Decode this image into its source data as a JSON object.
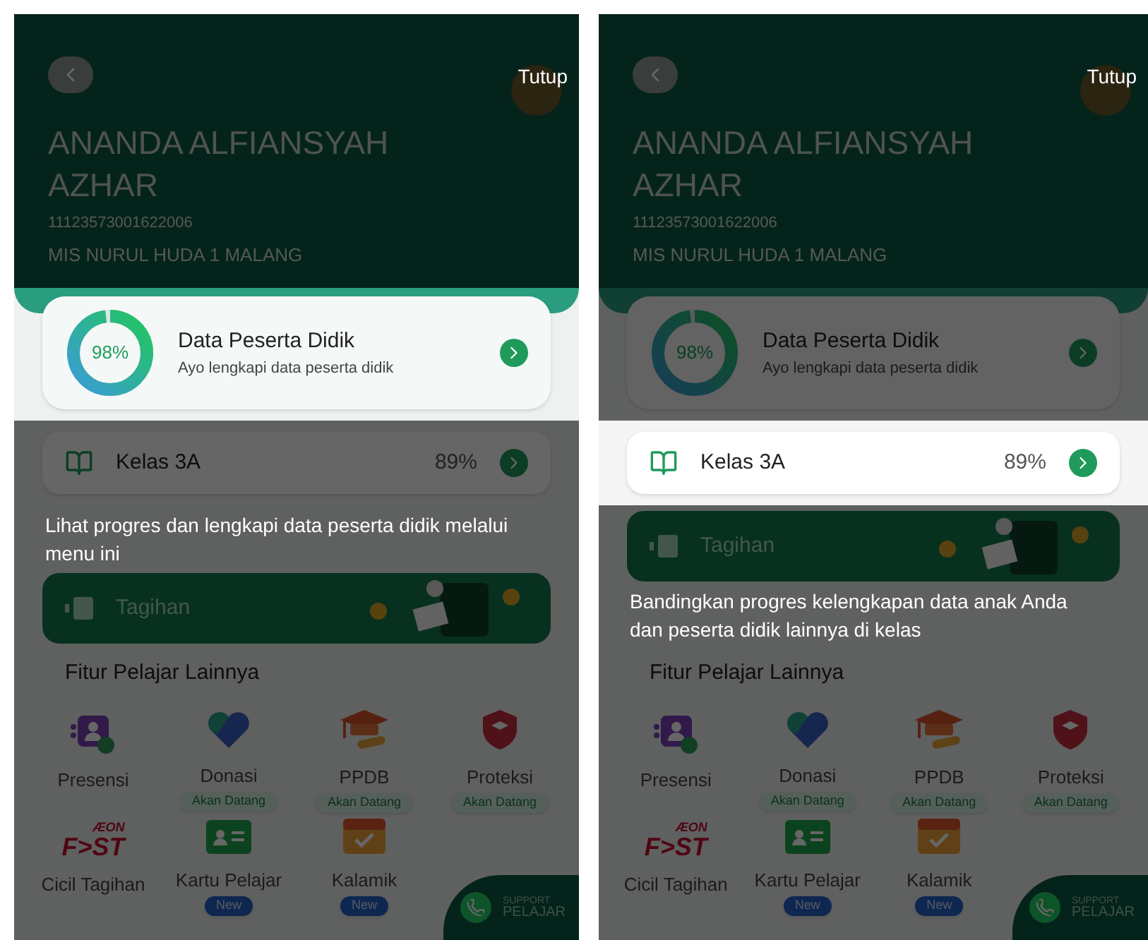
{
  "screens": [
    {
      "close_label": "Tutup",
      "tooltip": "Lihat progres dan lengkapi data peserta didik melalui menu ini",
      "student": {
        "name": "ANANDA ALFIANSYAH AZHAR",
        "id_number": "11123573001622006",
        "school": "MIS NURUL HUDA 1 MALANG"
      },
      "data_card": {
        "highlighted": true,
        "percent": "98%",
        "level": 0.98,
        "title": "Data Peserta Didik",
        "subtitle": "Ayo lengkapi data peserta didik"
      },
      "class_row": {
        "highlighted": false,
        "label": "Kelas 3A",
        "percent": "89%"
      },
      "billing_banner": {
        "label": "Tagihan"
      },
      "features_title": "Fitur Pelajar Lainnya",
      "features": [
        {
          "kind": "presence",
          "label": "Presensi"
        },
        {
          "kind": "donation",
          "label": "Donasi",
          "badge": {
            "kind": "soon",
            "text": "Akan Datang"
          }
        },
        {
          "kind": "graduation",
          "label": "PPDB",
          "badge": {
            "kind": "soon",
            "text": "Akan Datang"
          }
        },
        {
          "kind": "shield",
          "label": "Proteksi",
          "badge": {
            "kind": "soon",
            "text": "Akan Datang"
          }
        },
        {
          "kind": "logo",
          "label": "Cicil Tagihan",
          "logo": [
            "ÆON",
            "F>ST"
          ]
        },
        {
          "kind": "card",
          "label": "Kartu Pelajar",
          "badge": {
            "kind": "new",
            "text": "New"
          }
        },
        {
          "kind": "calendar",
          "label": "Kalamik",
          "badge": {
            "kind": "new",
            "text": "New"
          }
        }
      ],
      "support": [
        "SUPPORT",
        "PELAJAR"
      ]
    },
    {
      "close_label": "Tutup",
      "tooltip": "Bandingkan progres kelengkapan data anak Anda dan peserta didik lainnya di kelas",
      "student": {
        "name": "ANANDA ALFIANSYAH AZHAR",
        "id_number": "11123573001622006",
        "school": "MIS NURUL HUDA 1 MALANG"
      },
      "data_card": {
        "highlighted": false,
        "percent": "98%",
        "level": 0.98,
        "title": "Data Peserta Didik",
        "subtitle": "Ayo lengkapi data peserta didik"
      },
      "class_row": {
        "highlighted": true,
        "label": "Kelas 3A",
        "percent": "89%"
      },
      "billing_banner": {
        "label": "Tagihan"
      },
      "features_title": "Fitur Pelajar Lainnya",
      "features": [
        {
          "kind": "presence",
          "label": "Presensi"
        },
        {
          "kind": "donation",
          "label": "Donasi",
          "badge": {
            "kind": "soon",
            "text": "Akan Datang"
          }
        },
        {
          "kind": "graduation",
          "label": "PPDB",
          "badge": {
            "kind": "soon",
            "text": "Akan Datang"
          }
        },
        {
          "kind": "shield",
          "label": "Proteksi",
          "badge": {
            "kind": "soon",
            "text": "Akan Datang"
          }
        },
        {
          "kind": "logo",
          "label": "Cicil Tagihan",
          "logo": [
            "ÆON",
            "F>ST"
          ]
        },
        {
          "kind": "card",
          "label": "Kartu Pelajar",
          "badge": {
            "kind": "new",
            "text": "New"
          }
        },
        {
          "kind": "calendar",
          "label": "Kalamik",
          "badge": {
            "kind": "new",
            "text": "New"
          }
        }
      ],
      "support": [
        "SUPPORT",
        "PELAJAR"
      ]
    }
  ]
}
